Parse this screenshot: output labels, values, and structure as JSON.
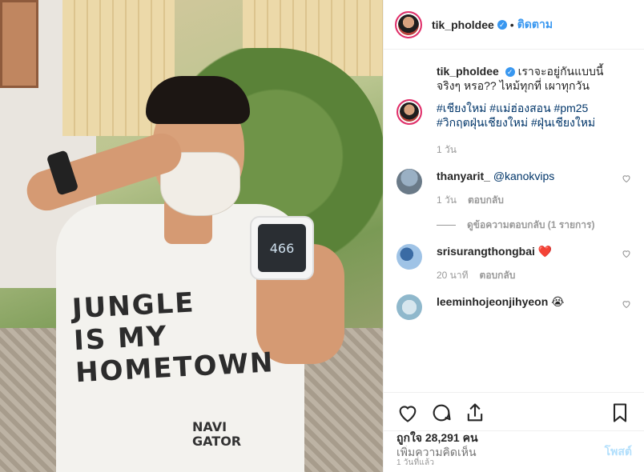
{
  "photo": {
    "device_reading": "466",
    "shirt_lines": [
      "JUNGLE",
      "IS MY",
      "HOMETOWN"
    ],
    "shirt_logo": "NAVI\nGATOR"
  },
  "header": {
    "username": "tik_pholdee",
    "follow_label": "ติดตาม",
    "dot": "•"
  },
  "caption": {
    "username": "tik_pholdee",
    "text": "เราจะอยู่กันแบบนี้จริงๆ หรอ?? ไหม้ทุกที่ เผาทุกวัน",
    "hashtags": "#เชียงใหม่ #แม่ฮ่องสอน #pm25 #วิกฤตฝุ่นเชียงใหม่ #ฝุ่นเชียงใหม่",
    "time": "1 วัน"
  },
  "comments": [
    {
      "username": "thanyarit_",
      "text": "@kanokvips",
      "time": "1 วัน",
      "reply_label": "ตอบกลับ"
    },
    {
      "username": "srisurangthongbai",
      "text": "❤️",
      "time": "20 นาที",
      "reply_label": "ตอบกลับ"
    },
    {
      "username": "leeminhojeonjihyeon",
      "text": "😭"
    }
  ],
  "view_replies": "ดูข้อความตอบกลับ (1 รายการ)",
  "actions": {
    "likes": "ถูกใจ 28,291 คน",
    "timestamp": "1 วันที่แล้ว"
  },
  "add_comment": {
    "placeholder": "เพิ่มความคิดเห็น",
    "post_label": "โพสต์"
  },
  "colors": {
    "link": "#3897f0",
    "hashtag": "#003569",
    "heart": "#ed4956"
  },
  "icons": [
    "heart-icon",
    "comment-icon",
    "share-icon",
    "bookmark-icon",
    "verified-icon"
  ]
}
